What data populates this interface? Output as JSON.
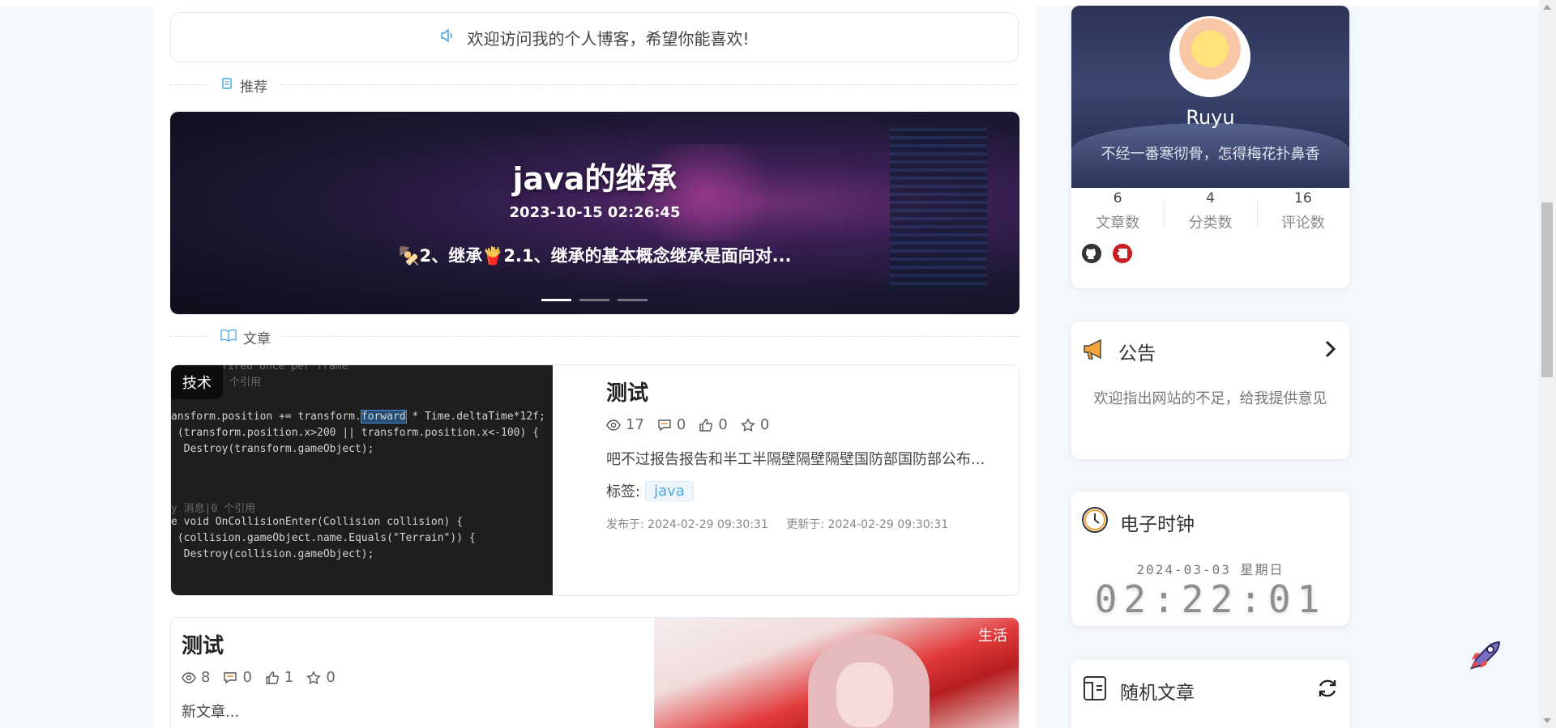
{
  "notice": {
    "text": "欢迎访问我的个人博客，希望你能喜欢!"
  },
  "sections": {
    "recommend": "推荐",
    "articles": "文章"
  },
  "banner": {
    "title": "java的继承",
    "date": "2023-10-15 02:26:45",
    "summary": "🍢2、继承🍟2.1、继承的基本概念继承是面向对..."
  },
  "posts": [
    {
      "category": "技术",
      "title": "测试",
      "views": "17",
      "comments": "0",
      "likes": "0",
      "favorites": "0",
      "excerpt": "吧不过报告报告和半工半隔壁隔壁隔壁国防部国防部公布...",
      "tags_label": "标签:",
      "tag": "java",
      "published": "发布于: 2024-02-29 09:30:31",
      "updated": "更新于: 2024-02-29 09:30:31",
      "code_lines": [
        "fired once per frame",
        "个引用",
        "ansform.position += transform.",
        "forward",
        " * Time.deltaTime*12f;",
        " (transform.position.x>200 || transform.position.x<-100) {",
        "  Destroy(transform.gameObject);",
        "y 消息|0 个引用",
        "e void OnCollisionEnter(Collision collision) {",
        " (collision.gameObject.name.Equals(\"Terrain\")) {",
        "  Destroy(collision.gameObject);"
      ]
    },
    {
      "category": "生活",
      "title": "测试",
      "views": "8",
      "comments": "0",
      "likes": "1",
      "favorites": "0",
      "excerpt": "新文章..."
    }
  ],
  "profile": {
    "name": "Ruyu",
    "motto": "不经一番寒彻骨，怎得梅花扑鼻香",
    "stats": [
      {
        "num": "6",
        "label": "文章数"
      },
      {
        "num": "4",
        "label": "分类数"
      },
      {
        "num": "16",
        "label": "评论数"
      }
    ]
  },
  "announcement": {
    "title": "公告",
    "body": "欢迎指出网站的不足，给我提供意见"
  },
  "clock": {
    "title": "电子时钟",
    "date": "2024-03-03 星期日",
    "time": "02:22:01"
  },
  "random": {
    "title": "随机文章"
  },
  "colors": {
    "accent": "#49a6dd",
    "background": "#f3f8fd"
  }
}
